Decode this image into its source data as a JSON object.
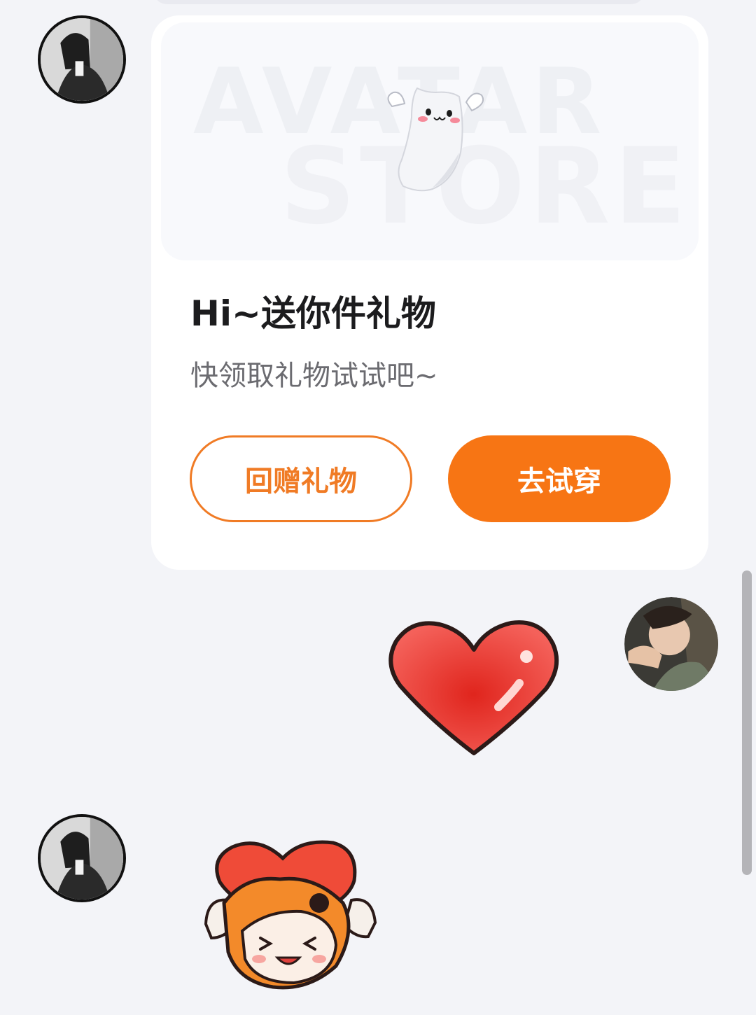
{
  "gift_card": {
    "banner_watermark_line1": "AVATAR",
    "banner_watermark_line2": "STORE",
    "title": "Hi~送你件礼物",
    "subtitle": "快领取礼物试试吧~",
    "return_gift_button": "回赠礼物",
    "try_on_button": "去试穿"
  },
  "colors": {
    "accent": "#f77514",
    "page_background": "#f3f4f8",
    "card_background": "#ffffff"
  },
  "icons": {
    "ghost": "ghost-mascot-icon",
    "heart": "heart-sticker",
    "hug_sticker": "heart-hug-sticker"
  }
}
